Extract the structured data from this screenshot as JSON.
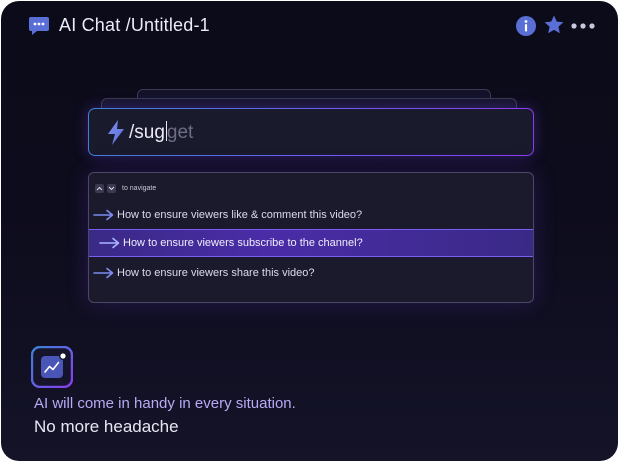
{
  "window": {
    "title": "AI Chat /Untitled-1"
  },
  "icons": {
    "chat": "chat-bubble-icon",
    "info": "info-icon",
    "star": "star-icon",
    "more": "more-horizontal-icon",
    "command": "lightning-bolt-icon",
    "feature": "trend-chart-icon"
  },
  "command": {
    "typed": "/sug",
    "autocomplete_hint": "get"
  },
  "suggestions": {
    "nav_hint": "to navigate",
    "items": [
      {
        "label": "How to ensure viewers like & comment this video?"
      },
      {
        "label": "How to ensure viewers subscribe to the channel?"
      },
      {
        "label": "How to ensure viewers share this video?"
      }
    ],
    "selected_index": 1
  },
  "footer": {
    "tagline_primary": "AI will come in handy in every situation.",
    "tagline_secondary": "No more headache"
  },
  "colors": {
    "background": "#0c0b1a",
    "accent_purple": "#6b5cf6",
    "accent_blue": "#3b82d6",
    "highlight_row": "#4a2ca7",
    "tagline_accent": "#b9a9f6"
  }
}
